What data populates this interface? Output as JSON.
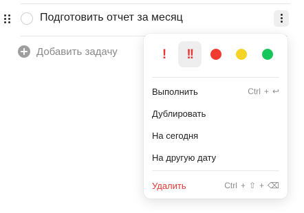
{
  "task": {
    "title": "Подготовить отчет за месяц"
  },
  "add_task": {
    "label": "Добавить задачу"
  },
  "menu": {
    "priorities": [
      {
        "name": "priority-low",
        "glyph": "!",
        "type": "bang",
        "color": "#e53935",
        "selected": false
      },
      {
        "name": "priority-high",
        "glyph": "!!",
        "type": "bang",
        "color": "#e53935",
        "selected": true
      },
      {
        "name": "priority-red",
        "type": "dot",
        "color": "#f23b2f",
        "selected": false
      },
      {
        "name": "priority-yellow",
        "type": "dot",
        "color": "#f5d327",
        "selected": false
      },
      {
        "name": "priority-green",
        "type": "dot",
        "color": "#16c65a",
        "selected": false
      }
    ],
    "items": {
      "complete": {
        "label": "Выполнить",
        "shortcut_mod": "Ctrl",
        "shortcut_plus": "+",
        "shortcut_key": "↩"
      },
      "duplicate": {
        "label": "Дублировать"
      },
      "today": {
        "label": "На сегодня"
      },
      "other_date": {
        "label": "На другую дату"
      },
      "delete": {
        "label": "Удалить",
        "shortcut_mod": "Ctrl",
        "shortcut_plus": "+",
        "shortcut_shift": "⇧",
        "shortcut_key": "⌫"
      }
    }
  },
  "colors": {
    "danger": "#e53935",
    "text": "#1f1f1f",
    "muted": "#8c8c8c"
  }
}
